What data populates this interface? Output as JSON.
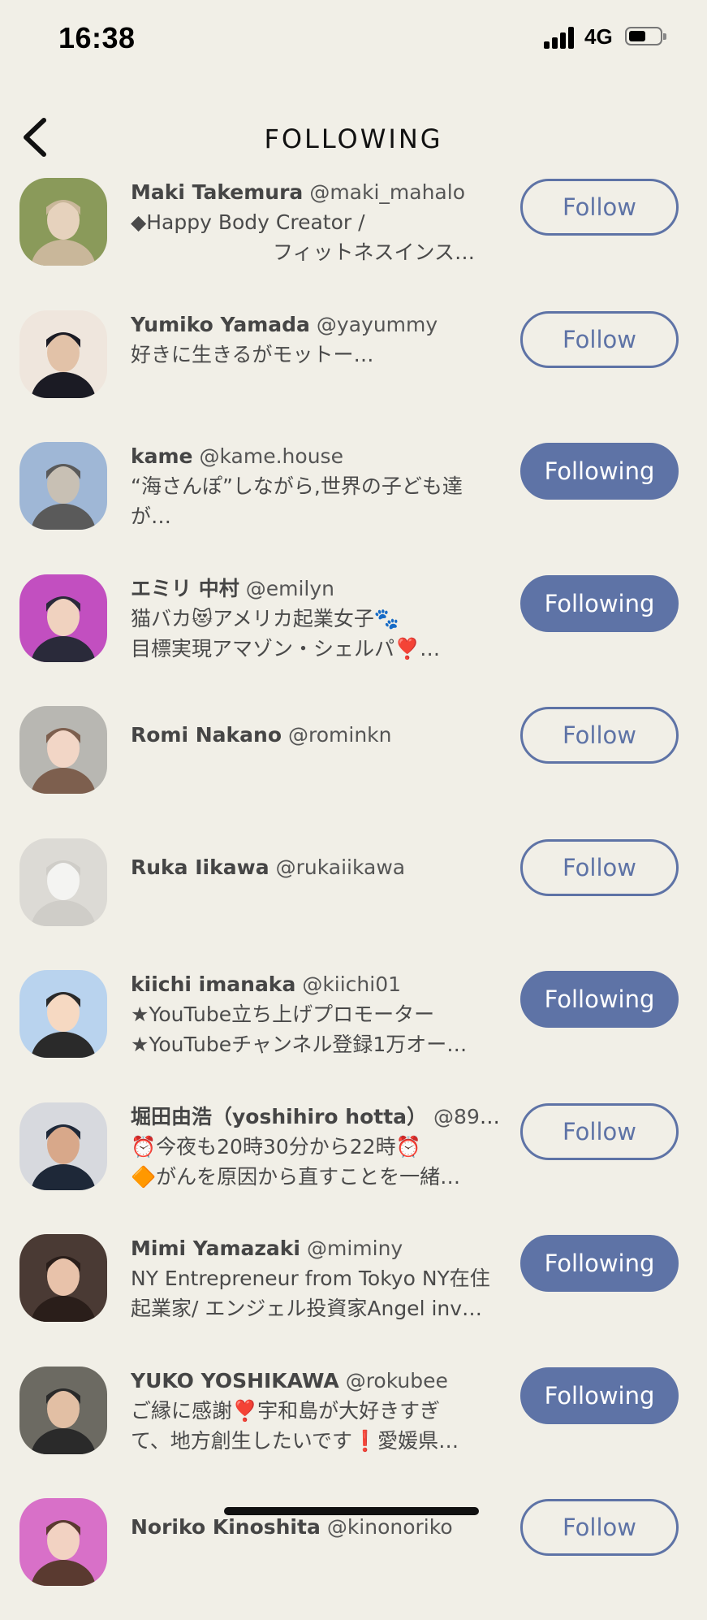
{
  "status_bar": {
    "time": "16:38",
    "network": "4G"
  },
  "header": {
    "title": "FOLLOWING",
    "back_icon": "chevron-left-icon"
  },
  "colors": {
    "background": "#f1efe7",
    "accent": "#5e73a6"
  },
  "users": [
    {
      "name": "Maki Takemura",
      "handle": "@maki_mahalo",
      "bio": "◆Happy Body Creator /\n　　　　　　　フィットネスインス…",
      "button": "Follow",
      "following": false,
      "avatar_colors": [
        "#8a9a5a",
        "#c9b79a",
        "#e6d2bd"
      ]
    },
    {
      "name": "Yumiko Yamada",
      "handle": "@yayummy",
      "bio": "好きに生きるがモットー…",
      "button": "Follow",
      "following": false,
      "avatar_colors": [
        "#efe6dd",
        "#1b1b24",
        "#e2c2a8"
      ]
    },
    {
      "name": "kame",
      "handle": "@kame.house",
      "bio": "“海さんぽ”しながら,世界の子ども達\nが…",
      "button": "Following",
      "following": true,
      "avatar_colors": [
        "#9fb7d6",
        "#5a5a5a",
        "#c8c0b4"
      ]
    },
    {
      "name": "エミリ 中村",
      "handle": "@emilyn",
      "bio": "猫バカ😻アメリカ起業女子🐾\n目標実現アマゾン・シェルパ❣️…",
      "button": "Following",
      "following": true,
      "avatar_colors": [
        "#c24fc0",
        "#2a2a3a",
        "#f0d2bf"
      ]
    },
    {
      "name": "Romi Nakano",
      "handle": "@rominkn",
      "bio": "",
      "button": "Follow",
      "following": false,
      "avatar_colors": [
        "#b8b7b2",
        "#7d5f4e",
        "#f2d6c6"
      ]
    },
    {
      "name": "Ruka Iikawa",
      "handle": "@rukaiikawa",
      "bio": "",
      "button": "Follow",
      "following": false,
      "avatar_colors": [
        "#dcdad5",
        "#cfcdc8",
        "#f4f4f2"
      ]
    },
    {
      "name": "kiichi imanaka",
      "handle": "@kiichi01",
      "bio": "★YouTube立ち上げプロモーター\n★YouTubeチャンネル登録1万オー…",
      "button": "Following",
      "following": true,
      "avatar_colors": [
        "#b9d3ee",
        "#2a2a2a",
        "#f6d9c2"
      ]
    },
    {
      "name": "堀田由浩（yoshihiro hotta）",
      "handle": "@898…",
      "bio": "⏰今夜も20時30分から22時⏰\n🔶がんを原因から直すことを一緒…",
      "button": "Follow",
      "following": false,
      "avatar_colors": [
        "#d7d9de",
        "#1e2838",
        "#d8a88a"
      ]
    },
    {
      "name": "Mimi Yamazaki",
      "handle": "@miminy",
      "bio": "NY Entrepreneur from Tokyo NY在住\n起業家/ エンジェル投資家Angel inv…",
      "button": "Following",
      "following": true,
      "avatar_colors": [
        "#4a3a34",
        "#2a1e1a",
        "#e8c2aa"
      ]
    },
    {
      "name": "YUKO YOSHIKAWA",
      "handle": "@rokubee",
      "bio": "ご縁に感謝❣️宇和島が大好きすぎ\nて、地方創生したいです❗愛媛県…",
      "button": "Following",
      "following": true,
      "avatar_colors": [
        "#6c6a62",
        "#2a2a2a",
        "#e2bfa4"
      ]
    },
    {
      "name": "Noriko Kinoshita",
      "handle": "@kinonoriko",
      "bio": "",
      "button": "Follow",
      "following": false,
      "avatar_colors": [
        "#d870c8",
        "#5a3a30",
        "#f2d2c2"
      ]
    }
  ]
}
